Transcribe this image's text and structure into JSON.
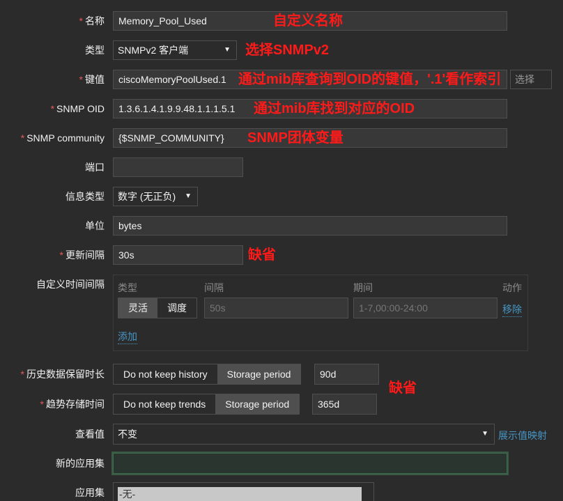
{
  "form": {
    "name": {
      "label": "名称",
      "value": "Memory_Pool_Used",
      "note": "自定义名称"
    },
    "type": {
      "label": "类型",
      "value": "SNMPv2 客户端",
      "note": "选择SNMPv2"
    },
    "key": {
      "label": "键值",
      "value": "ciscoMemoryPoolUsed.1",
      "note": "通过mib库查询到OID的键值，'.1'看作索引",
      "select_button": "选择"
    },
    "oid": {
      "label": "SNMP OID",
      "value": "1.3.6.1.4.1.9.9.48.1.1.1.5.1",
      "note": "通过mib库找到对应的OID"
    },
    "community": {
      "label": "SNMP community",
      "value": "{$SNMP_COMMUNITY}",
      "note": "SNMP团体变量"
    },
    "port": {
      "label": "端口",
      "value": ""
    },
    "info_type": {
      "label": "信息类型",
      "value": "数字 (无正负)"
    },
    "units": {
      "label": "单位",
      "value": "bytes"
    },
    "interval": {
      "label": "更新间隔",
      "value": "30s",
      "note": "缺省"
    },
    "custom_intervals": {
      "label": "自定义时间间隔",
      "headers": {
        "type": "类型",
        "interval": "间隔",
        "period": "期间",
        "action": "动作"
      },
      "row": {
        "flexible": "灵活",
        "scheduling": "调度",
        "interval_placeholder": "50s",
        "period_placeholder": "1-7,00:00-24:00",
        "remove": "移除"
      },
      "add": "添加"
    },
    "history": {
      "label": "历史数据保留时长",
      "opt_no": "Do not keep history",
      "opt_period": "Storage period",
      "value": "90d"
    },
    "trends": {
      "label": "趋势存储时间",
      "opt_no": "Do not keep trends",
      "opt_period": "Storage period",
      "value": "365d",
      "note": "缺省"
    },
    "valuemap": {
      "label": "查看值",
      "value": "不变",
      "link": "展示值映射"
    },
    "new_app": {
      "label": "新的应用集",
      "value": ""
    },
    "apps": {
      "label": "应用集",
      "first": "-无-"
    }
  }
}
